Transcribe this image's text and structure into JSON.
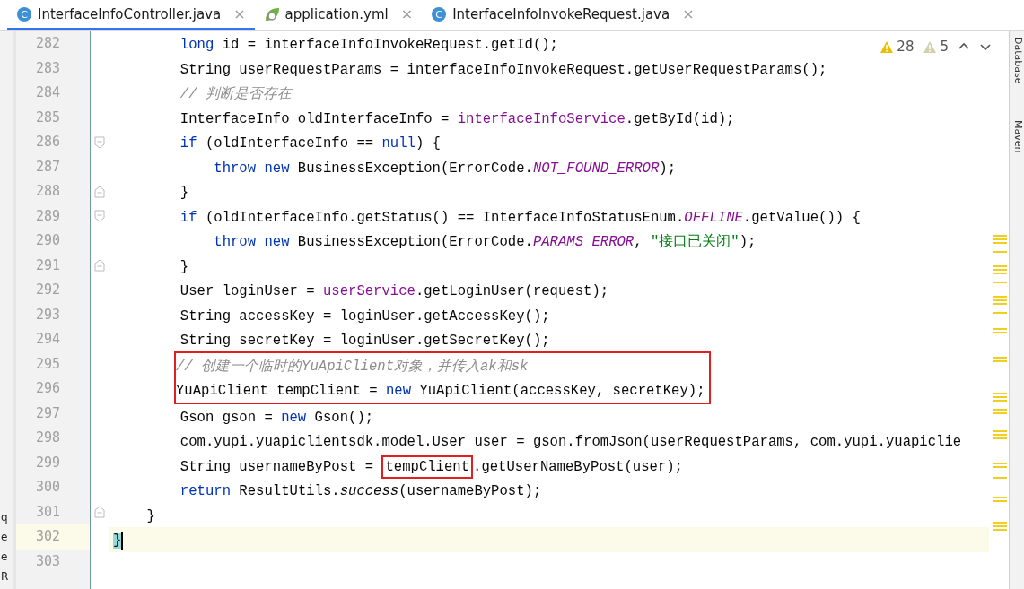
{
  "tabs": [
    {
      "label": "InterfaceInfoController.java",
      "selected": true,
      "icon": {
        "kind": "class",
        "letter": "C"
      },
      "close": "×"
    },
    {
      "label": "application.yml",
      "selected": false,
      "icon": {
        "kind": "yaml"
      },
      "close": "×"
    },
    {
      "label": "InterfaceInfoInvokeRequest.java",
      "selected": false,
      "icon": {
        "kind": "class",
        "letter": "C"
      },
      "close": "×"
    }
  ],
  "inspections": [
    {
      "kind": "warning",
      "count": "28"
    },
    {
      "kind": "weak_warning",
      "count": "5"
    }
  ],
  "left_panel_fragments": [
    "q",
    "e",
    "e",
    "R"
  ],
  "right_tool_windows": [
    "Database",
    "Maven"
  ],
  "editor": {
    "lines": [
      {
        "number": "282",
        "fold_start": false,
        "fold_end": false,
        "tokens": [
          {
            "kind": "keyword",
            "text": "        long"
          },
          {
            "kind": "plain",
            "text": " id = interfaceInfoInvokeRequest.getId();"
          }
        ]
      },
      {
        "number": "283",
        "fold_start": false,
        "fold_end": false,
        "tokens": [
          {
            "kind": "plain",
            "text": "        String userRequestParams = interfaceInfoInvokeRequest.getUserRequestParams();"
          }
        ]
      },
      {
        "number": "284",
        "fold_start": false,
        "fold_end": false,
        "tokens": [
          {
            "kind": "comment",
            "text": "        // 判断是否存在"
          }
        ]
      },
      {
        "number": "285",
        "fold_start": false,
        "fold_end": false,
        "tokens": [
          {
            "kind": "plain",
            "text": "        InterfaceInfo oldInterfaceInfo = "
          },
          {
            "kind": "field",
            "text": "interfaceInfoService"
          },
          {
            "kind": "plain",
            "text": ".getById(id);"
          }
        ]
      },
      {
        "number": "286",
        "fold_start": true,
        "fold_end": false,
        "tokens": [
          {
            "kind": "keyword",
            "text": "        if"
          },
          {
            "kind": "plain",
            "text": " (oldInterfaceInfo == "
          },
          {
            "kind": "keyword",
            "text": "null"
          },
          {
            "kind": "plain",
            "text": ") {"
          }
        ]
      },
      {
        "number": "287",
        "fold_start": false,
        "fold_end": false,
        "tokens": [
          {
            "kind": "keyword",
            "text": "            throw new"
          },
          {
            "kind": "plain",
            "text": " BusinessException(ErrorCode."
          },
          {
            "kind": "static_field",
            "text": "NOT_FOUND_ERROR"
          },
          {
            "kind": "plain",
            "text": ");"
          }
        ]
      },
      {
        "number": "288",
        "fold_start": false,
        "fold_end": true,
        "tokens": [
          {
            "kind": "plain",
            "text": "        }"
          }
        ]
      },
      {
        "number": "289",
        "fold_start": true,
        "fold_end": false,
        "tokens": [
          {
            "kind": "keyword",
            "text": "        if"
          },
          {
            "kind": "plain",
            "text": " (oldInterfaceInfo.getStatus() == InterfaceInfoStatusEnum."
          },
          {
            "kind": "static_field",
            "text": "OFFLINE"
          },
          {
            "kind": "plain",
            "text": ".getValue()) {"
          }
        ]
      },
      {
        "number": "290",
        "fold_start": false,
        "fold_end": false,
        "tokens": [
          {
            "kind": "keyword",
            "text": "            throw new"
          },
          {
            "kind": "plain",
            "text": " BusinessException(ErrorCode."
          },
          {
            "kind": "static_field",
            "text": "PARAMS_ERROR"
          },
          {
            "kind": "plain",
            "text": ", "
          },
          {
            "kind": "string",
            "text": "\"接口已关闭\""
          },
          {
            "kind": "plain",
            "text": ");"
          }
        ]
      },
      {
        "number": "291",
        "fold_start": false,
        "fold_end": true,
        "tokens": [
          {
            "kind": "plain",
            "text": "        }"
          }
        ]
      },
      {
        "number": "292",
        "fold_start": false,
        "fold_end": false,
        "tokens": [
          {
            "kind": "plain",
            "text": "        User loginUser = "
          },
          {
            "kind": "field",
            "text": "userService"
          },
          {
            "kind": "plain",
            "text": ".getLoginUser(request);"
          }
        ]
      },
      {
        "number": "293",
        "fold_start": false,
        "fold_end": false,
        "tokens": [
          {
            "kind": "plain",
            "text": "        String accessKey = loginUser.getAccessKey();"
          }
        ]
      },
      {
        "number": "294",
        "fold_start": false,
        "fold_end": false,
        "tokens": [
          {
            "kind": "plain",
            "text": "        String secretKey = loginUser.getSecretKey();"
          }
        ]
      },
      {
        "number": "295",
        "fold_start": false,
        "fold_end": false,
        "boxed": true,
        "tokens": [
          {
            "kind": "comment",
            "text": "        // 创建一个临时的YuApiClient对象，并传入ak和sk"
          }
        ]
      },
      {
        "number": "296",
        "fold_start": false,
        "fold_end": false,
        "boxed": true,
        "tokens": [
          {
            "kind": "plain",
            "text": "        YuApiClient tempClient = "
          },
          {
            "kind": "keyword",
            "text": "new"
          },
          {
            "kind": "plain",
            "text": " YuApiClient(accessKey, secretKey);"
          }
        ]
      },
      {
        "number": "297",
        "fold_start": false,
        "fold_end": false,
        "tokens": [
          {
            "kind": "plain",
            "text": "        Gson gson = "
          },
          {
            "kind": "keyword",
            "text": "new"
          },
          {
            "kind": "plain",
            "text": " Gson();"
          }
        ]
      },
      {
        "number": "298",
        "fold_start": false,
        "fold_end": false,
        "tokens": [
          {
            "kind": "plain",
            "text": "        com.yupi.yuapiclientsdk.model.User user = gson.fromJson(userRequestParams, com.yupi.yuapiclie"
          }
        ]
      },
      {
        "number": "299",
        "fold_start": false,
        "fold_end": false,
        "tokens": [
          {
            "kind": "plain",
            "text": "        String usernameByPost = "
          },
          {
            "kind": "plain",
            "text": "tempClient",
            "boxed": true
          },
          {
            "kind": "plain",
            "text": ".getUserNameByPost(user);"
          }
        ]
      },
      {
        "number": "300",
        "fold_start": false,
        "fold_end": false,
        "tokens": [
          {
            "kind": "keyword",
            "text": "        return"
          },
          {
            "kind": "plain",
            "text": " ResultUtils."
          },
          {
            "kind": "static_method",
            "text": "success"
          },
          {
            "kind": "plain",
            "text": "(usernameByPost);"
          }
        ]
      },
      {
        "number": "301",
        "fold_start": false,
        "fold_end": true,
        "tokens": [
          {
            "kind": "plain",
            "text": "    }"
          }
        ]
      },
      {
        "number": "302",
        "fold_start": false,
        "fold_end": false,
        "current": true,
        "tokens": [
          {
            "kind": "matched_brace",
            "text": "}"
          }
        ]
      },
      {
        "number": "303",
        "fold_start": false,
        "fold_end": false
      }
    ]
  }
}
